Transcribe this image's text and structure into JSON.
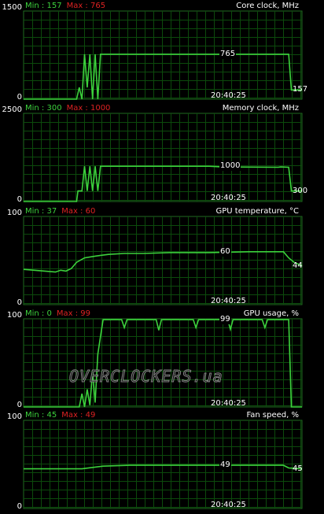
{
  "time_label": "20:40:25",
  "watermark": "OVERCLOCKERS.ua",
  "colors": {
    "background": "#000000",
    "grid": "#0c4a0c",
    "line": "#3cd13c",
    "min_label": "#3cd13c",
    "max_label": "#dd2222",
    "text": "#ffffff"
  },
  "graphs": [
    {
      "id": "core-clock",
      "title": "Core clock, MHz",
      "min_text": "Min : 157",
      "max_text": "Max : 765",
      "axis_top": "1500",
      "axis_bottom": "0",
      "range": [
        0,
        1500
      ],
      "current_text": "157",
      "peak_text": "765",
      "series": [
        [
          0,
          0
        ],
        [
          20,
          0
        ],
        [
          21,
          200
        ],
        [
          22,
          0
        ],
        [
          23,
          765
        ],
        [
          24,
          200
        ],
        [
          25,
          765
        ],
        [
          26,
          0
        ],
        [
          27,
          765
        ],
        [
          28,
          0
        ],
        [
          29,
          765
        ],
        [
          60,
          765
        ],
        [
          100,
          765
        ],
        [
          101,
          157
        ],
        [
          105,
          157
        ]
      ]
    },
    {
      "id": "memory-clock",
      "title": "Memory clock, MHz",
      "min_text": "Min : 300",
      "max_text": "Max : 1000",
      "axis_top": "2500",
      "axis_bottom": "0",
      "range": [
        0,
        2500
      ],
      "current_text": "300",
      "peak_text": "1000",
      "series": [
        [
          0,
          0
        ],
        [
          20,
          0
        ],
        [
          20.5,
          300
        ],
        [
          22,
          300
        ],
        [
          23,
          1000
        ],
        [
          24,
          300
        ],
        [
          25,
          1000
        ],
        [
          26,
          300
        ],
        [
          27,
          1000
        ],
        [
          28,
          300
        ],
        [
          29,
          1000
        ],
        [
          60,
          1000
        ],
        [
          70,
          1000
        ],
        [
          75,
          980
        ],
        [
          96,
          970
        ],
        [
          97,
          980
        ],
        [
          100,
          970
        ],
        [
          101,
          300
        ],
        [
          105,
          300
        ]
      ]
    },
    {
      "id": "gpu-temperature",
      "title": "GPU temperature, °C",
      "min_text": "Min : 37",
      "max_text": "Max : 60",
      "axis_top": "100",
      "axis_bottom": "0",
      "range": [
        0,
        100
      ],
      "current_text": "44",
      "peak_text": "60",
      "series": [
        [
          0,
          40
        ],
        [
          4,
          39
        ],
        [
          8,
          38
        ],
        [
          12,
          37
        ],
        [
          14,
          39
        ],
        [
          16,
          38
        ],
        [
          18,
          41
        ],
        [
          20,
          48
        ],
        [
          23,
          53
        ],
        [
          27,
          55
        ],
        [
          32,
          57
        ],
        [
          38,
          58
        ],
        [
          45,
          58
        ],
        [
          55,
          59
        ],
        [
          70,
          59
        ],
        [
          85,
          60
        ],
        [
          98,
          60
        ],
        [
          100,
          53
        ],
        [
          102,
          48
        ],
        [
          105,
          44
        ]
      ]
    },
    {
      "id": "gpu-usage",
      "title": "GPU usage, %",
      "min_text": "Min : 0",
      "max_text": "Max : 99",
      "axis_top": "100",
      "axis_bottom": "0",
      "range": [
        0,
        100
      ],
      "current_text": "",
      "peak_text": "99",
      "series": [
        [
          0,
          0
        ],
        [
          21,
          0
        ],
        [
          22,
          15
        ],
        [
          23,
          0
        ],
        [
          24,
          20
        ],
        [
          25,
          2
        ],
        [
          26,
          40
        ],
        [
          27,
          5
        ],
        [
          28,
          60
        ],
        [
          29,
          80
        ],
        [
          30,
          99
        ],
        [
          37,
          99
        ],
        [
          38,
          90
        ],
        [
          39,
          99
        ],
        [
          50,
          99
        ],
        [
          51,
          87
        ],
        [
          52,
          99
        ],
        [
          64,
          99
        ],
        [
          65,
          90
        ],
        [
          66,
          99
        ],
        [
          77,
          99
        ],
        [
          78,
          88
        ],
        [
          79,
          99
        ],
        [
          90,
          99
        ],
        [
          91,
          90
        ],
        [
          92,
          99
        ],
        [
          100,
          99
        ],
        [
          101,
          0
        ],
        [
          105,
          0
        ]
      ]
    },
    {
      "id": "fan-speed",
      "title": "Fan speed, %",
      "min_text": "Min : 45",
      "max_text": "Max : 49",
      "axis_top": "100",
      "axis_bottom": "0",
      "range": [
        0,
        100
      ],
      "current_text": "45",
      "peak_text": "49",
      "series": [
        [
          0,
          45
        ],
        [
          15,
          45
        ],
        [
          22,
          45
        ],
        [
          30,
          48
        ],
        [
          40,
          49
        ],
        [
          60,
          49
        ],
        [
          98,
          49
        ],
        [
          100,
          46
        ],
        [
          105,
          45
        ]
      ]
    }
  ]
}
